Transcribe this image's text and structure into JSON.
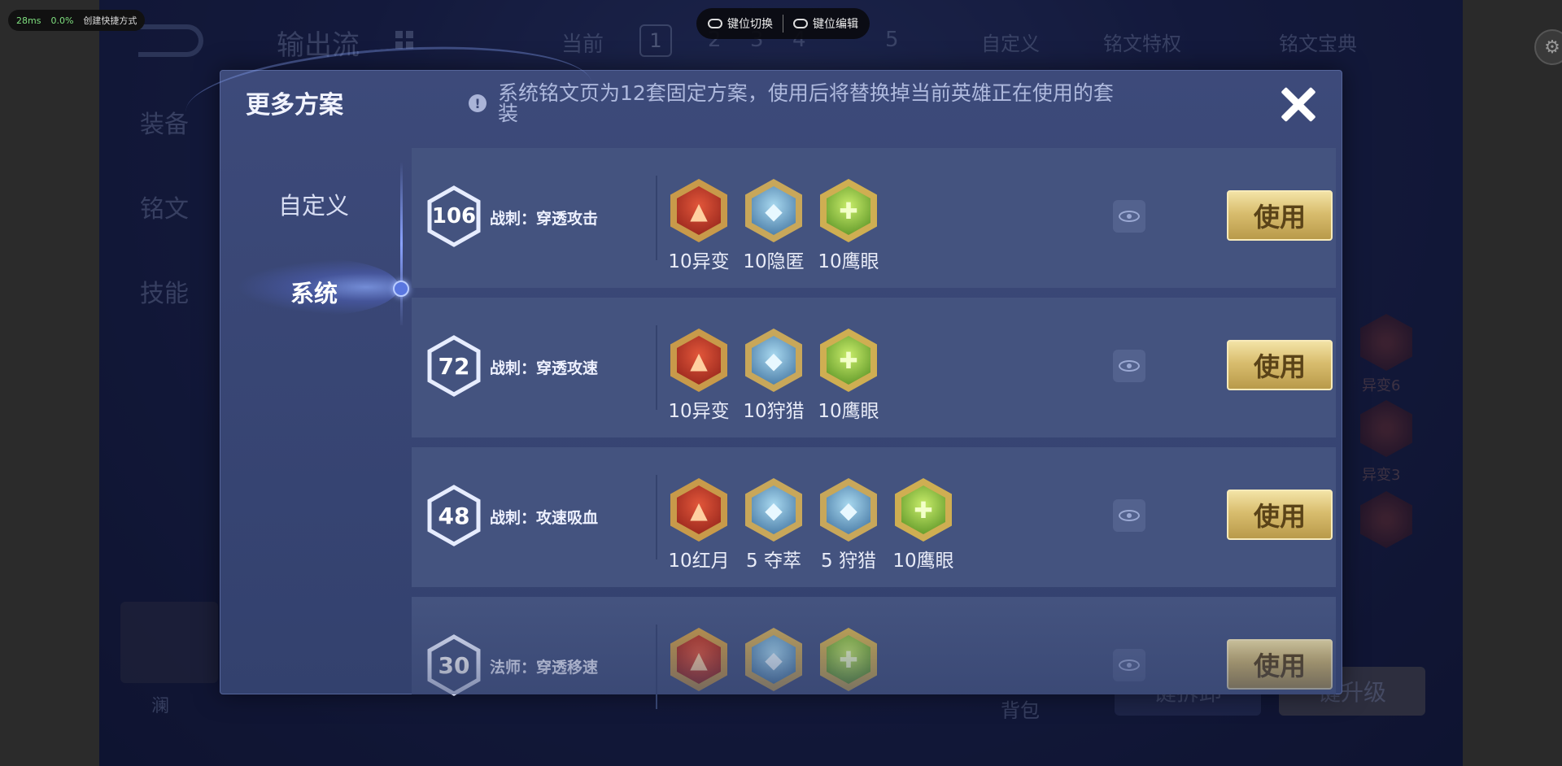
{
  "overlay": {
    "perf_ms": "28ms",
    "perf_pct": "0.0%",
    "shortcut_label": "创建快捷方式",
    "key_switch": "键位切换",
    "key_edit": "键位编辑"
  },
  "background": {
    "page_title": "输出流",
    "current_label": "当前",
    "page_numbers": [
      "1",
      "2",
      "3",
      "4",
      "5"
    ],
    "custom_label": "自定义",
    "rune_privilege": "铭文特权",
    "rune_codex": "铭文宝典",
    "side_tabs": [
      "装备",
      "铭文",
      "技能"
    ],
    "hero_name": "澜",
    "bag_label": "背包",
    "right_runes": [
      "异变6",
      "异变3"
    ],
    "upgrade_label": "键升级",
    "another_btn": "键拆卸"
  },
  "modal": {
    "title": "更多方案",
    "info": "系统铭文页为12套固定方案，使用后将替换掉当前英雄正在使用的套装",
    "tabs": {
      "custom": "自定义",
      "system": "系统"
    },
    "use_label": "使用",
    "rows": [
      {
        "level": "106",
        "name": "战刺：穿透攻击",
        "runes": [
          {
            "icon": "red-rune-icon",
            "color": "red",
            "label": "10异变"
          },
          {
            "icon": "blue-rune-icon",
            "color": "blue",
            "label": "10隐匿"
          },
          {
            "icon": "green-rune-icon",
            "color": "green",
            "label": "10鹰眼"
          }
        ]
      },
      {
        "level": "72",
        "name": "战刺：穿透攻速",
        "runes": [
          {
            "icon": "red-rune-icon",
            "color": "red",
            "label": "10异变"
          },
          {
            "icon": "blue-rune-icon",
            "color": "blue",
            "label": "10狩猎"
          },
          {
            "icon": "green-rune-icon",
            "color": "green",
            "label": "10鹰眼"
          }
        ]
      },
      {
        "level": "48",
        "name": "战刺：攻速吸血",
        "runes": [
          {
            "icon": "red-rune-icon",
            "color": "red",
            "label": "10红月"
          },
          {
            "icon": "blue-rune-icon",
            "color": "blue",
            "label": "5 夺萃"
          },
          {
            "icon": "blue-rune-icon",
            "color": "blue",
            "label": "5 狩猎"
          },
          {
            "icon": "green-rune-icon",
            "color": "green",
            "label": "10鹰眼"
          }
        ]
      },
      {
        "level": "30",
        "name": "法师：穿透移速",
        "runes": [
          {
            "icon": "red-rune-icon",
            "color": "red",
            "label": ""
          },
          {
            "icon": "blue-rune-icon",
            "color": "blue",
            "label": ""
          },
          {
            "icon": "green-rune-icon",
            "color": "green",
            "label": ""
          }
        ]
      }
    ]
  }
}
